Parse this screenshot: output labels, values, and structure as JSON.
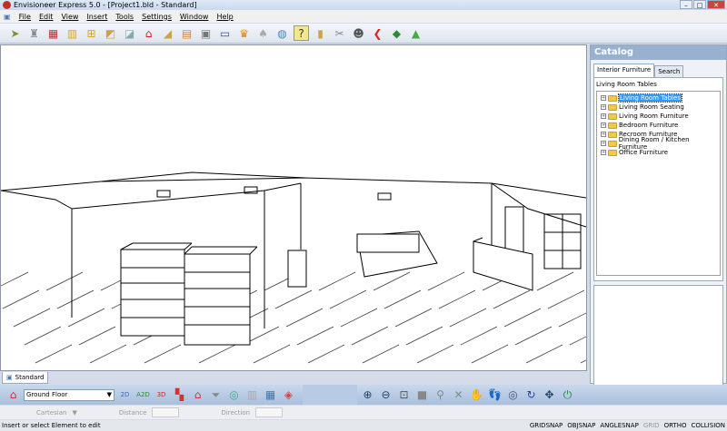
{
  "title": "Envisioneer Express 5.0 - [Project1.bld - Standard]",
  "menu": [
    "File",
    "Edit",
    "View",
    "Insert",
    "Tools",
    "Settings",
    "Window",
    "Help"
  ],
  "toolbar_icons": [
    "select",
    "paint",
    "wall",
    "door",
    "window",
    "stairs-rail",
    "floor",
    "roof",
    "stairs",
    "cabinet",
    "appliance",
    "electronics",
    "furniture",
    "lamp",
    "fixture",
    "help",
    "book",
    "tools",
    "person-help",
    "undo",
    "tree",
    "plant"
  ],
  "catalog": {
    "title": "Catalog",
    "tabs": [
      "Interior Furniture",
      "Search"
    ],
    "current": "Living Room Tables",
    "items": [
      "Living Room Tables",
      "Living Room Seating",
      "Living Room Furniture",
      "Bedroom Furniture",
      "Recroom Furniture",
      "Dining Room / Kitchen Furniture",
      "Office Furniture"
    ],
    "selected_index": 0
  },
  "view_tab": "Standard",
  "floor": "Ground Floor",
  "coords": {
    "mode": "Cartesian",
    "distance_label": "Distance",
    "direction_label": "Direction"
  },
  "status": {
    "message": "Insert or select Element to edit",
    "toggles": [
      {
        "label": "GRIDSNAP",
        "on": true
      },
      {
        "label": "OBJSNAP",
        "on": true
      },
      {
        "label": "ANGLESNAP",
        "on": true
      },
      {
        "label": "GRID",
        "on": false
      },
      {
        "label": "ORTHO",
        "on": true
      },
      {
        "label": "COLLISION",
        "on": true
      }
    ]
  }
}
